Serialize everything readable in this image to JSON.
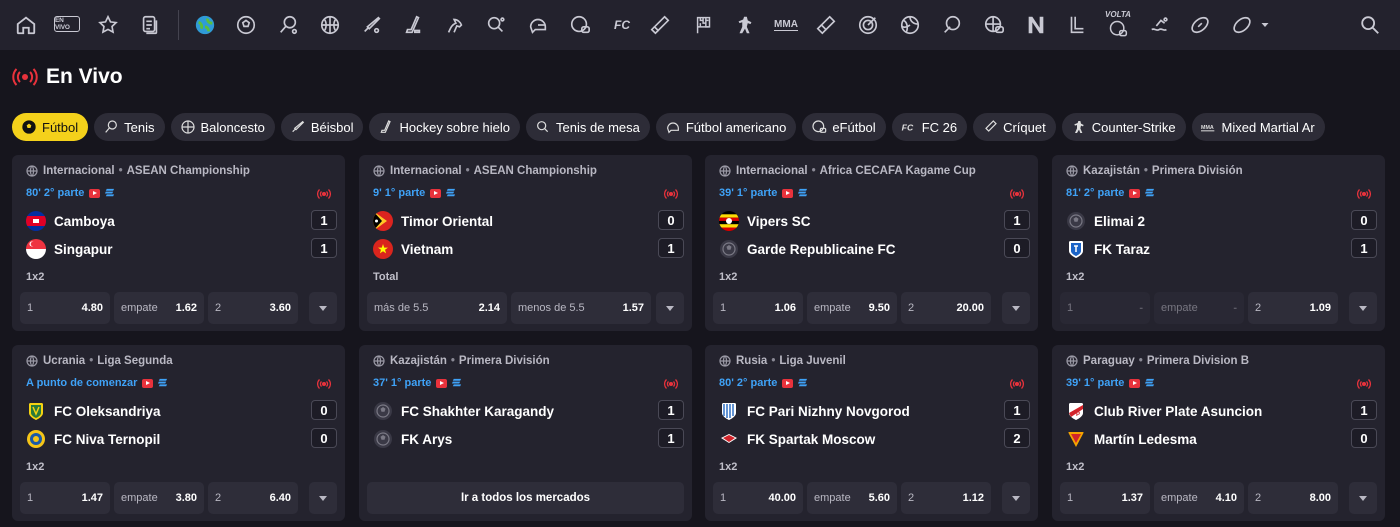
{
  "nav": {
    "envivo_badge": "EN VIVO",
    "fc_label": "FC",
    "mma_label": "MMA",
    "volta_label": "VOLTA"
  },
  "heading": {
    "title": "En Vivo"
  },
  "chips": [
    {
      "label": "Fútbol",
      "icon": "soccer-ball-icon",
      "active": true
    },
    {
      "label": "Tenis",
      "icon": "tennis-racket-icon"
    },
    {
      "label": "Baloncesto",
      "icon": "basketball-icon"
    },
    {
      "label": "Béisbol",
      "icon": "baseball-bat-icon"
    },
    {
      "label": "Hockey sobre hielo",
      "icon": "hockey-stick-icon"
    },
    {
      "label": "Tenis de mesa",
      "icon": "ping-pong-icon"
    },
    {
      "label": "Fútbol americano",
      "icon": "football-helmet-icon"
    },
    {
      "label": "eFútbol",
      "icon": "efootball-icon"
    },
    {
      "label": "FC 26",
      "icon": "fc-icon"
    },
    {
      "label": "Críquet",
      "icon": "cricket-bat-icon"
    },
    {
      "label": "Counter-Strike",
      "icon": "counter-strike-icon"
    },
    {
      "label": "Mixed Martial Ar",
      "icon": "mma-icon"
    }
  ],
  "cards": [
    {
      "country": "Internacional",
      "league": "ASEAN Championship",
      "time": "80' 2° parte",
      "home": "Camboya",
      "away": "Singapur",
      "home_score": "1",
      "away_score": "1",
      "market": "1x2",
      "odds": [
        {
          "l": "1",
          "v": "4.80"
        },
        {
          "l": "empate",
          "v": "1.62"
        },
        {
          "l": "2",
          "v": "3.60"
        }
      ]
    },
    {
      "country": "Internacional",
      "league": "ASEAN Championship",
      "time": "9' 1° parte",
      "home": "Timor Oriental",
      "away": "Vietnam",
      "home_score": "0",
      "away_score": "1",
      "market": "Total",
      "odds": [
        {
          "l": "más de 5.5",
          "v": "2.14"
        },
        {
          "l": "menos de 5.5",
          "v": "1.57"
        }
      ]
    },
    {
      "country": "Internacional",
      "league": "Africa CECAFA Kagame Cup",
      "time": "39' 1° parte",
      "home": "Vipers SC",
      "away": "Garde Republicaine FC",
      "home_score": "1",
      "away_score": "0",
      "market": "1x2",
      "odds": [
        {
          "l": "1",
          "v": "1.06"
        },
        {
          "l": "empate",
          "v": "9.50"
        },
        {
          "l": "2",
          "v": "20.00"
        }
      ]
    },
    {
      "country": "Kazajistán",
      "league": "Primera División",
      "time": "81' 2° parte",
      "home": "Elimai 2",
      "away": "FK Taraz",
      "home_score": "0",
      "away_score": "1",
      "market": "1x2",
      "odds": [
        {
          "l": "1",
          "v": "-"
        },
        {
          "l": "empate",
          "v": "-"
        },
        {
          "l": "2",
          "v": "1.09"
        }
      ]
    },
    {
      "country": "Ucrania",
      "league": "Liga Segunda",
      "time": "A punto de comenzar",
      "home": "FC Oleksandriya",
      "away": "FC Niva Ternopil",
      "home_score": "0",
      "away_score": "0",
      "market": "1x2",
      "odds": [
        {
          "l": "1",
          "v": "1.47"
        },
        {
          "l": "empate",
          "v": "3.80"
        },
        {
          "l": "2",
          "v": "6.40"
        }
      ]
    },
    {
      "country": "Kazajistán",
      "league": "Primera División",
      "time": "37' 1° parte",
      "home": "FC Shakhter Karagandy",
      "away": "FK Arys",
      "home_score": "1",
      "away_score": "1",
      "all_markets": "Ir a todos los mercados"
    },
    {
      "country": "Rusia",
      "league": "Liga Juvenil",
      "time": "80' 2° parte",
      "home": "FC Pari Nizhny Novgorod",
      "away": "FK Spartak Moscow",
      "home_score": "1",
      "away_score": "2",
      "market": "1x2",
      "odds": [
        {
          "l": "1",
          "v": "40.00"
        },
        {
          "l": "empate",
          "v": "5.60"
        },
        {
          "l": "2",
          "v": "1.12"
        }
      ]
    },
    {
      "country": "Paraguay",
      "league": "Primera Division B",
      "time": "39' 1° parte",
      "home": "Club River Plate Asuncion",
      "away": "Martín Ledesma",
      "home_score": "1",
      "away_score": "0",
      "market": "1x2",
      "odds": [
        {
          "l": "1",
          "v": "1.37"
        },
        {
          "l": "empate",
          "v": "4.10"
        },
        {
          "l": "2",
          "v": "8.00"
        }
      ]
    }
  ],
  "colors": {
    "accent": "#f4d11b",
    "live": "#e8323c",
    "time": "#3fa2f7"
  }
}
